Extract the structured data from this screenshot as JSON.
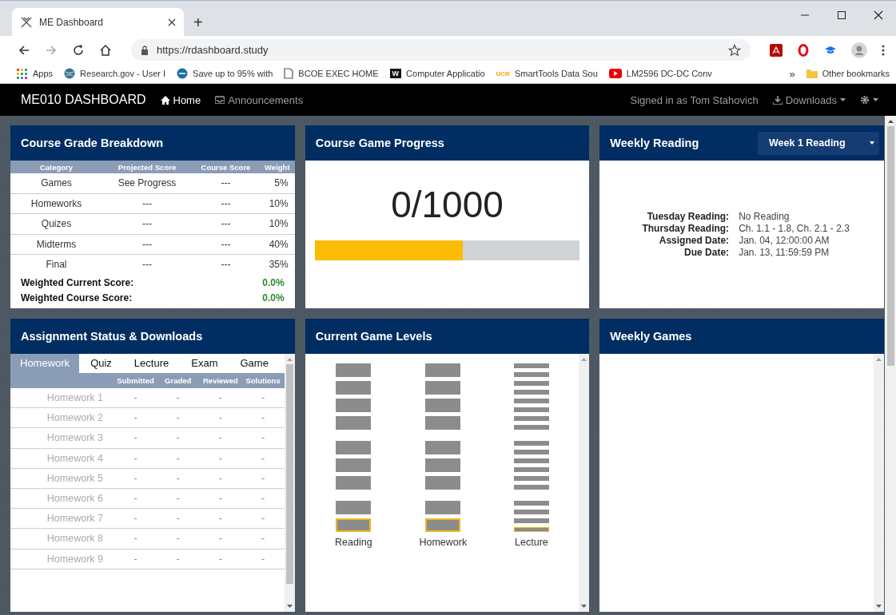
{
  "browser": {
    "tab_title": "ME Dashboard",
    "new_tab": "+",
    "url": "https://rdashboard.study",
    "bookmarks": [
      {
        "label": "Apps",
        "kind": "grid"
      },
      {
        "label": "Research.gov - User I",
        "kind": "globe"
      },
      {
        "label": "Save up to 95% with",
        "kind": "badge"
      },
      {
        "label": "BCOE EXEC HOME",
        "kind": "page"
      },
      {
        "label": "Computer Applicatio",
        "kind": "letter",
        "icon_text": "W"
      },
      {
        "label": "SmartTools Data Sou",
        "kind": "tag",
        "icon_text": "UCR"
      },
      {
        "label": "LM2596 DC-DC Conv",
        "kind": "video"
      }
    ],
    "overflow": "»",
    "other_bookmarks": "Other bookmarks"
  },
  "navbar": {
    "brand": "ME010 DASHBOARD",
    "links": [
      {
        "label": "Home",
        "kind": "home",
        "selected": true
      },
      {
        "label": "Announcements",
        "kind": "inbox",
        "selected": false
      }
    ],
    "signed_in": "Signed in as Tom Stahovich",
    "downloads": "Downloads"
  },
  "grade_breakdown": {
    "title": "Course Grade Breakdown",
    "columns": [
      "Category",
      "Projected Score",
      "Course Score",
      "Weight"
    ],
    "rows": [
      [
        "Games",
        "See Progress",
        "---",
        "5%"
      ],
      [
        "Homeworks",
        "---",
        "---",
        "10%"
      ],
      [
        "Quizes",
        "---",
        "---",
        "10%"
      ],
      [
        "Midterms",
        "---",
        "---",
        "40%"
      ],
      [
        "Final",
        "---",
        "---",
        "35%"
      ]
    ],
    "totals": [
      {
        "label": "Weighted Current Score:",
        "value": "0.0%"
      },
      {
        "label": "Weighted Course Score:",
        "value": "0.0%"
      }
    ]
  },
  "game_progress": {
    "title": "Course Game Progress",
    "score": "0/1000",
    "level": 0.56
  },
  "weekly_reading": {
    "title": "Weekly Reading",
    "week": "Week 1 Reading",
    "fields": [
      {
        "label": "Tuesday Reading:",
        "value": "No Reading"
      },
      {
        "label": "Thursday Reading:",
        "value": "Ch. 1.1 - 1.8, Ch. 2.1 - 2.3"
      },
      {
        "label": "Assigned Date:",
        "value": "Jan. 04, 12:00:00 AM"
      },
      {
        "label": "Due Date:",
        "value": "Jan. 13, 11:59:59 PM"
      }
    ]
  },
  "assignments": {
    "title": "Assignment Status & Downloads",
    "tabs": [
      {
        "label": "Homework",
        "selected": true
      },
      {
        "label": "Quiz",
        "selected": false
      },
      {
        "label": "Lecture",
        "selected": false
      },
      {
        "label": "Exam",
        "selected": false
      },
      {
        "label": "Game",
        "selected": false
      }
    ],
    "columns": [
      "",
      "Submitted",
      "Graded",
      "Reviewed",
      "Solutions"
    ],
    "rows": [
      [
        "Homework 1",
        "-",
        "-",
        "-",
        "-"
      ],
      [
        "Homework 2",
        "-",
        "-",
        "-",
        "-"
      ],
      [
        "Homework 3",
        "-",
        "-",
        "-",
        "-"
      ],
      [
        "Homework 4",
        "-",
        "-",
        "-",
        "-"
      ],
      [
        "Homework 5",
        "-",
        "-",
        "-",
        "-"
      ],
      [
        "Homework 6",
        "-",
        "-",
        "-",
        "-"
      ],
      [
        "Homework 7",
        "-",
        "-",
        "-",
        "-"
      ],
      [
        "Homework 8",
        "-",
        "-",
        "-",
        "-"
      ],
      [
        "Homework 9",
        "-",
        "-",
        "-",
        "-"
      ]
    ]
  },
  "game_levels": {
    "title": "Current Game Levels",
    "columns": [
      {
        "label": "Reading",
        "kind": "block",
        "groups": [
          {
            "blocks": [
              {
                "selected": false
              },
              {
                "selected": false
              },
              {
                "selected": false
              },
              {
                "selected": false
              }
            ]
          },
          {
            "blocks": [
              {
                "selected": false
              },
              {
                "selected": false
              },
              {
                "selected": false
              }
            ]
          },
          {
            "blocks": [
              {
                "selected": false
              },
              {
                "selected": true
              }
            ]
          }
        ]
      },
      {
        "label": "Homework",
        "kind": "block",
        "groups": [
          {
            "blocks": [
              {
                "selected": false
              },
              {
                "selected": false
              },
              {
                "selected": false
              },
              {
                "selected": false
              }
            ]
          },
          {
            "blocks": [
              {
                "selected": false
              },
              {
                "selected": false
              },
              {
                "selected": false
              }
            ]
          },
          {
            "blocks": [
              {
                "selected": false
              },
              {
                "selected": true
              }
            ]
          }
        ]
      },
      {
        "label": "Lecture",
        "kind": "line",
        "groups": [
          {
            "blocks": [
              {
                "selected": false
              },
              {
                "selected": false
              },
              {
                "selected": false
              },
              {
                "selected": false
              },
              {
                "selected": false
              },
              {
                "selected": false
              },
              {
                "selected": false
              },
              {
                "selected": false
              }
            ]
          },
          {
            "blocks": [
              {
                "selected": false
              },
              {
                "selected": false
              },
              {
                "selected": false
              },
              {
                "selected": false
              },
              {
                "selected": false
              },
              {
                "selected": false
              }
            ]
          },
          {
            "blocks": [
              {
                "selected": false
              },
              {
                "selected": false
              },
              {
                "selected": false
              },
              {
                "selected": true
              }
            ]
          }
        ]
      }
    ]
  },
  "weekly_games": {
    "title": "Weekly Games"
  }
}
